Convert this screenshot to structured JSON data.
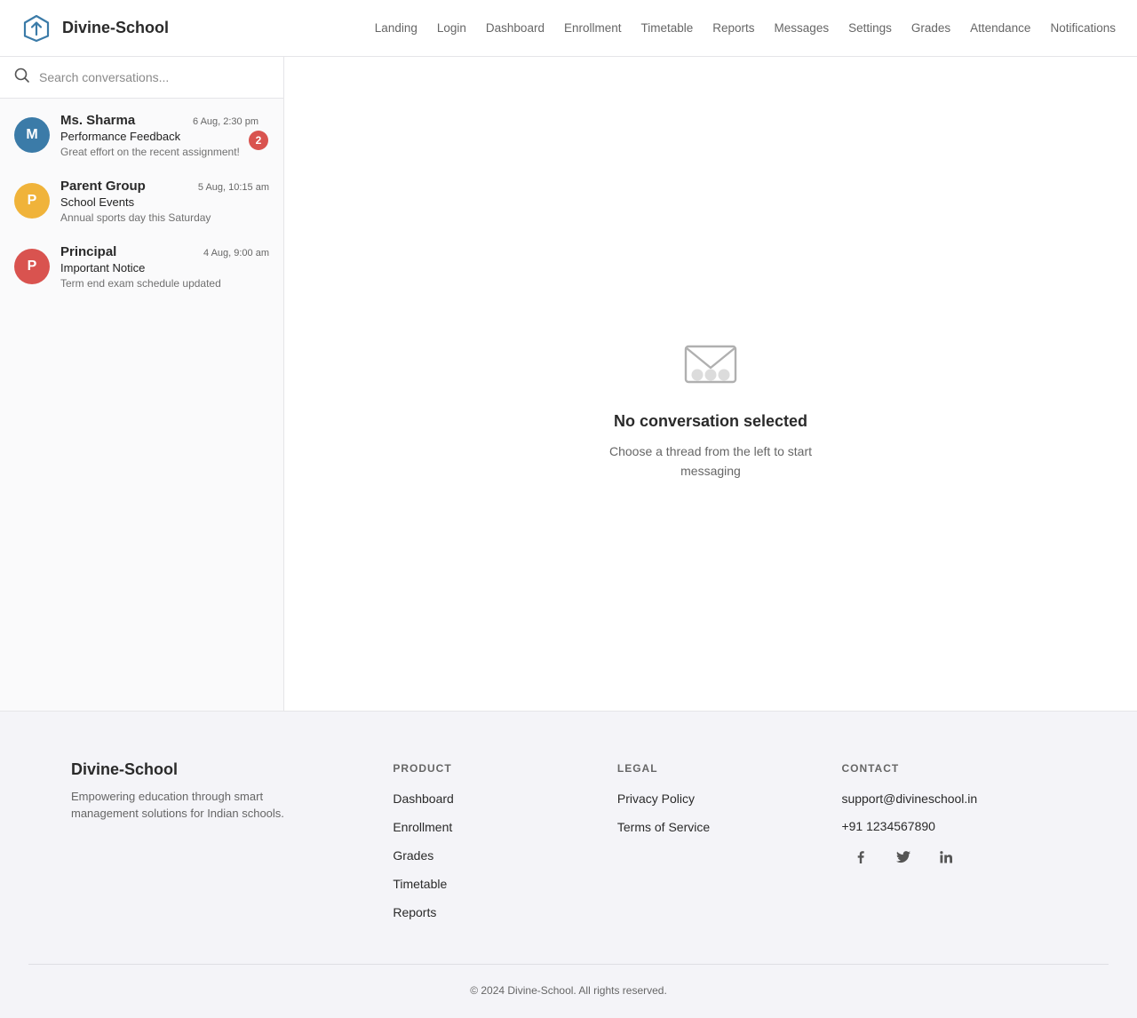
{
  "brand": {
    "name": "Divine-School"
  },
  "nav": {
    "items": [
      "Landing",
      "Login",
      "Dashboard",
      "Enrollment",
      "Timetable",
      "Reports",
      "Messages",
      "Settings",
      "Grades",
      "Attendance",
      "Notifications"
    ]
  },
  "search": {
    "placeholder": "Search conversations...",
    "value": ""
  },
  "conversations": [
    {
      "initial": "M",
      "name": "Ms. Sharma",
      "time": "6 Aug, 2:30 pm",
      "subject": "Performance Feedback",
      "preview": "Great effort on the recent assignment!",
      "unread": "2",
      "color": "#3b7ba8"
    },
    {
      "initial": "P",
      "name": "Parent Group",
      "time": "5 Aug, 10:15 am",
      "subject": "School Events",
      "preview": "Annual sports day this Saturday",
      "unread": "",
      "color": "#f0b33a"
    },
    {
      "initial": "P",
      "name": "Principal",
      "time": "4 Aug, 9:00 am",
      "subject": "Important Notice",
      "preview": "Term end exam schedule updated",
      "unread": "",
      "color": "#d9534f"
    }
  ],
  "empty_state": {
    "icon": "mail-icon",
    "title": "No conversation selected",
    "subtitle": "Choose a thread from the left to start messaging"
  },
  "footer": {
    "brand_name": "Divine-School",
    "tagline": "Empowering education through smart management solutions for Indian schools.",
    "product": {
      "title": "PRODUCT",
      "links": [
        "Dashboard",
        "Enrollment",
        "Grades",
        "Timetable",
        "Reports"
      ]
    },
    "legal": {
      "title": "LEGAL",
      "links": [
        "Privacy Policy",
        "Terms of Service"
      ]
    },
    "contact": {
      "title": "CONTACT",
      "email": "support@divineschool.in",
      "phone": "+91 1234567890"
    },
    "socials": [
      "facebook-icon",
      "twitter-icon",
      "linkedin-icon"
    ],
    "copyright": "© 2024 Divine-School. All rights reserved."
  }
}
